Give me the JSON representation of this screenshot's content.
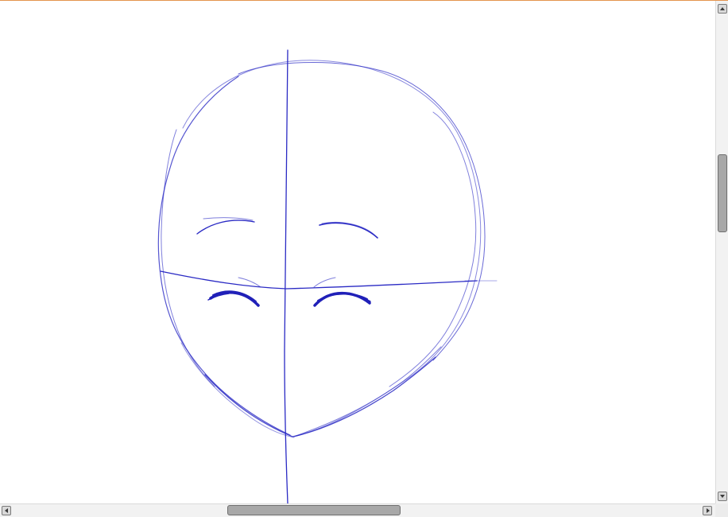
{
  "app": {
    "accent_color": "#e4944e",
    "stroke_color": "#2828c8"
  },
  "drawing": {
    "subject": "face-construction-sketch"
  },
  "scrollbars": {
    "vertical": {
      "up_icon": "arrow-up-icon",
      "down_icon": "arrow-down-icon",
      "position_fraction": 0.31
    },
    "horizontal": {
      "left_icon": "arrow-left-icon",
      "right_icon": "arrow-right-icon",
      "position_fraction": 0.38
    }
  }
}
